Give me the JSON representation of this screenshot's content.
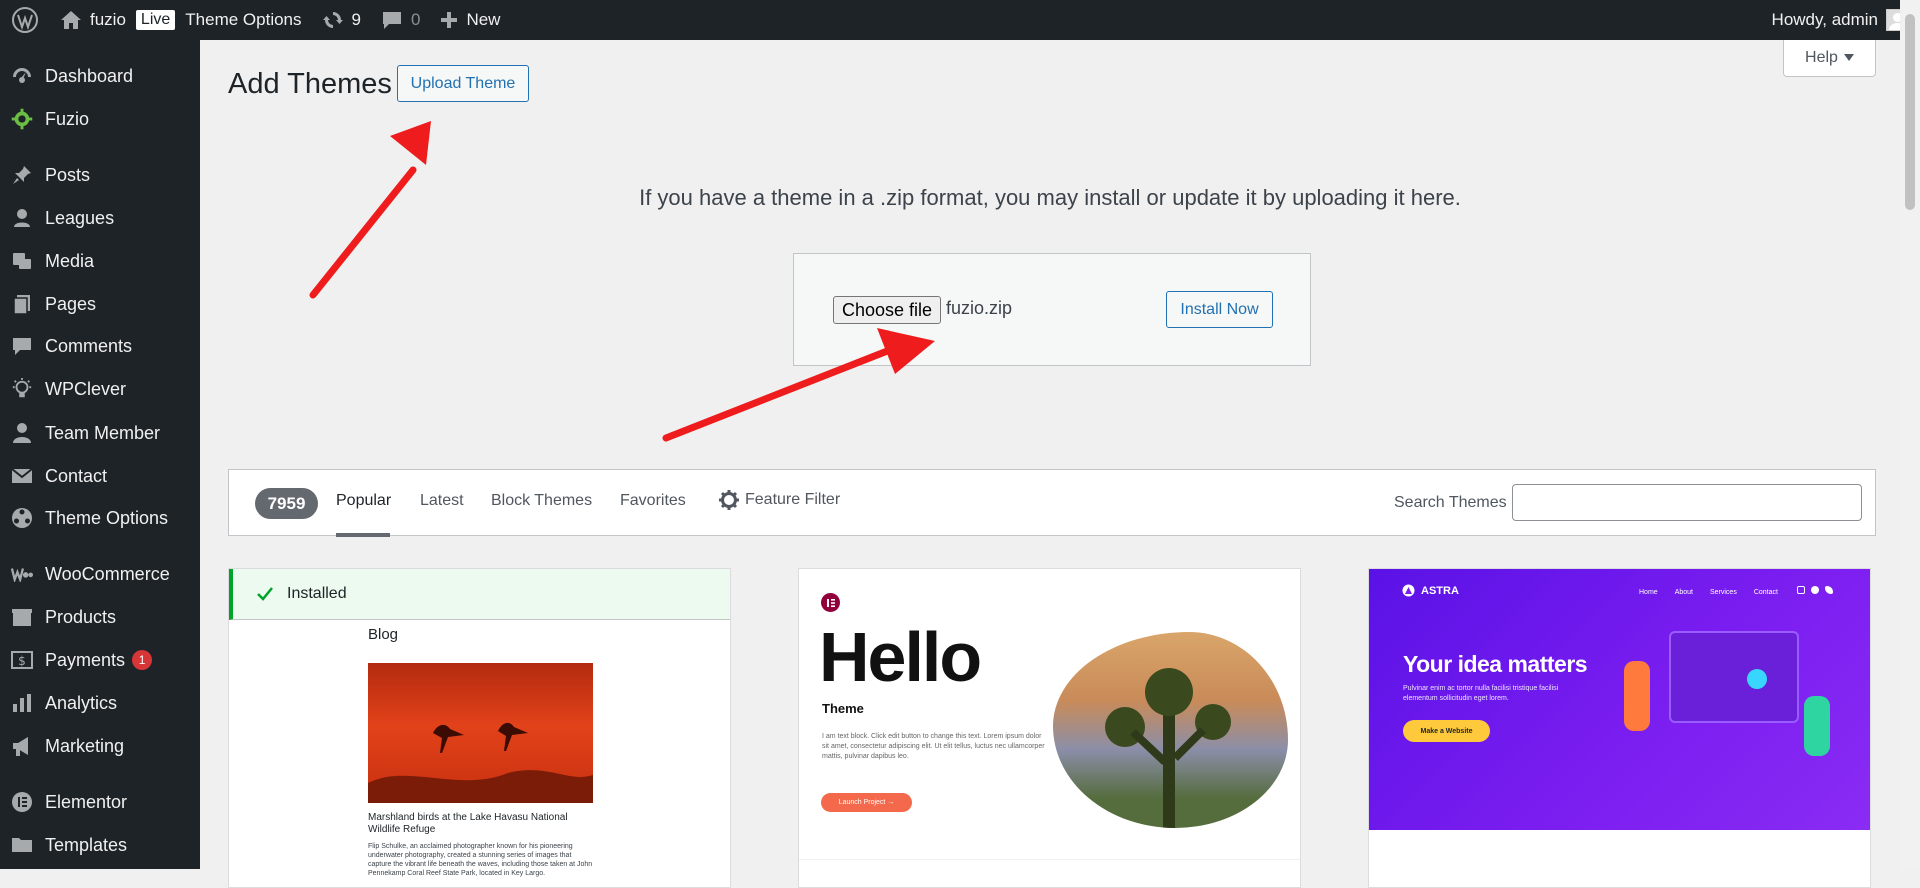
{
  "adminbar": {
    "site_name": "fuzio",
    "live_badge": "Live",
    "theme_options": "Theme Options",
    "updates_count": "9",
    "comments_count": "0",
    "new_label": "New",
    "howdy": "Howdy, admin"
  },
  "sidebar": {
    "items": [
      {
        "label": "Dashboard",
        "icon": "dashboard-icon"
      },
      {
        "label": "Fuzio",
        "icon": "fuzio-logo-icon"
      },
      {
        "label": "Posts",
        "icon": "pin-icon"
      },
      {
        "label": "Leagues",
        "icon": "leagues-icon"
      },
      {
        "label": "Media",
        "icon": "media-icon"
      },
      {
        "label": "Pages",
        "icon": "pages-icon"
      },
      {
        "label": "Comments",
        "icon": "comment-icon"
      },
      {
        "label": "WPClever",
        "icon": "lightbulb-icon"
      },
      {
        "label": "Team Member",
        "icon": "user-icon"
      },
      {
        "label": "Contact",
        "icon": "mail-icon"
      },
      {
        "label": "Theme Options",
        "icon": "options-icon"
      },
      {
        "label": "WooCommerce",
        "icon": "woocommerce-icon"
      },
      {
        "label": "Products",
        "icon": "products-icon"
      },
      {
        "label": "Payments",
        "icon": "payments-icon",
        "badge": "1"
      },
      {
        "label": "Analytics",
        "icon": "analytics-icon"
      },
      {
        "label": "Marketing",
        "icon": "megaphone-icon"
      },
      {
        "label": "Elementor",
        "icon": "elementor-icon"
      },
      {
        "label": "Templates",
        "icon": "folder-icon"
      }
    ]
  },
  "main": {
    "title": "Add Themes",
    "upload_button": "Upload Theme",
    "help": "Help",
    "upload_hint": "If you have a theme in a .zip format, you may install or update it by uploading it here.",
    "choose_file": "Choose file",
    "file_name": "fuzio.zip",
    "install_now": "Install Now"
  },
  "filter": {
    "count": "7959",
    "tabs": [
      "Popular",
      "Latest",
      "Block Themes",
      "Favorites"
    ],
    "feature_filter": "Feature Filter",
    "search_label": "Search Themes"
  },
  "cards": [
    {
      "installed": "Installed",
      "title": "Blog",
      "caption": "Marshland birds at the Lake Havasu National Wildlife Refuge",
      "text": "Flip Schulke, an acclaimed photographer known for his pioneering underwater photography, created a stunning series of images that capture the vibrant life beneath the waves, including those taken at John Pennekamp Coral Reef State Park, located in Key Largo."
    },
    {
      "heading": "Hello",
      "subheading": "Theme",
      "body": "I am text block. Click edit button to change this text. Lorem ipsum dolor sit amet, consectetur adipiscing elit. Ut elit tellus, luctus nec ullamcorper mattis, pulvinar dapibus leo.",
      "button": "Launch Project →"
    },
    {
      "brand": "ASTRA",
      "nav": [
        "Home",
        "About",
        "Services",
        "Contact"
      ],
      "heading": "Your idea matters",
      "body": "Pulvinar enim ac tortor nulla facilisi tristique facilisi elementum sollicitudin eget lorem.",
      "button": "Make a Website"
    }
  ],
  "colors": {
    "admin_dark": "#1d2327",
    "wp_blue": "#2271b1",
    "installed_green": "#00a32a",
    "astra_purple": "#7a1df0",
    "hello_orange": "#f4694b",
    "annotation_red": "#ee1c1c"
  }
}
